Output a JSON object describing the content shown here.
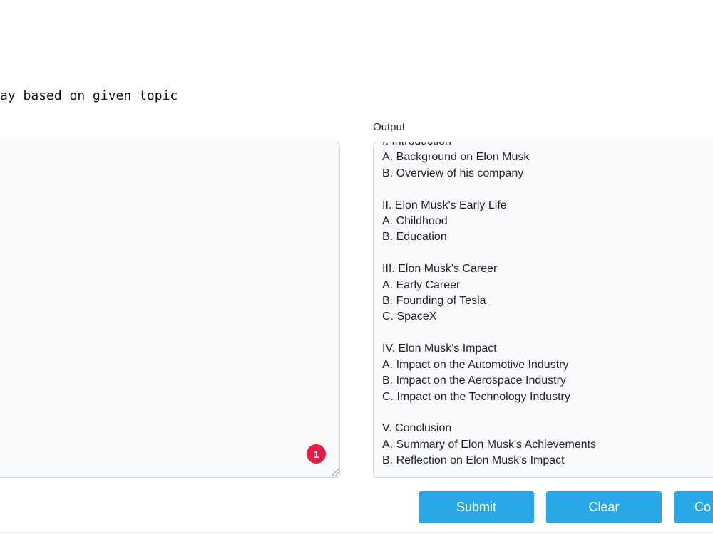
{
  "prompt": {
    "subtitle": "ay based on given topic"
  },
  "input": {
    "value": "",
    "badge_count": "1"
  },
  "output": {
    "label": "Output",
    "text": "I. Introduction\nA. Background on Elon Musk\nB. Overview of his company\n\nII. Elon Musk's Early Life\nA. Childhood\nB. Education\n\nIII. Elon Musk's Career\nA. Early Career\nB. Founding of Tesla\nC. SpaceX\n\nIV. Elon Musk's Impact\nA. Impact on the Automotive Industry\nB. Impact on the Aerospace Industry\nC. Impact on the Technology Industry\n\nV. Conclusion\nA. Summary of Elon Musk's Achievements\nB. Reflection on Elon Musk's Impact"
  },
  "buttons": {
    "submit": "Submit",
    "clear": "Clear",
    "copy": "Co"
  },
  "colors": {
    "button_bg": "#29a8e8",
    "badge_bg": "#e11d48"
  }
}
